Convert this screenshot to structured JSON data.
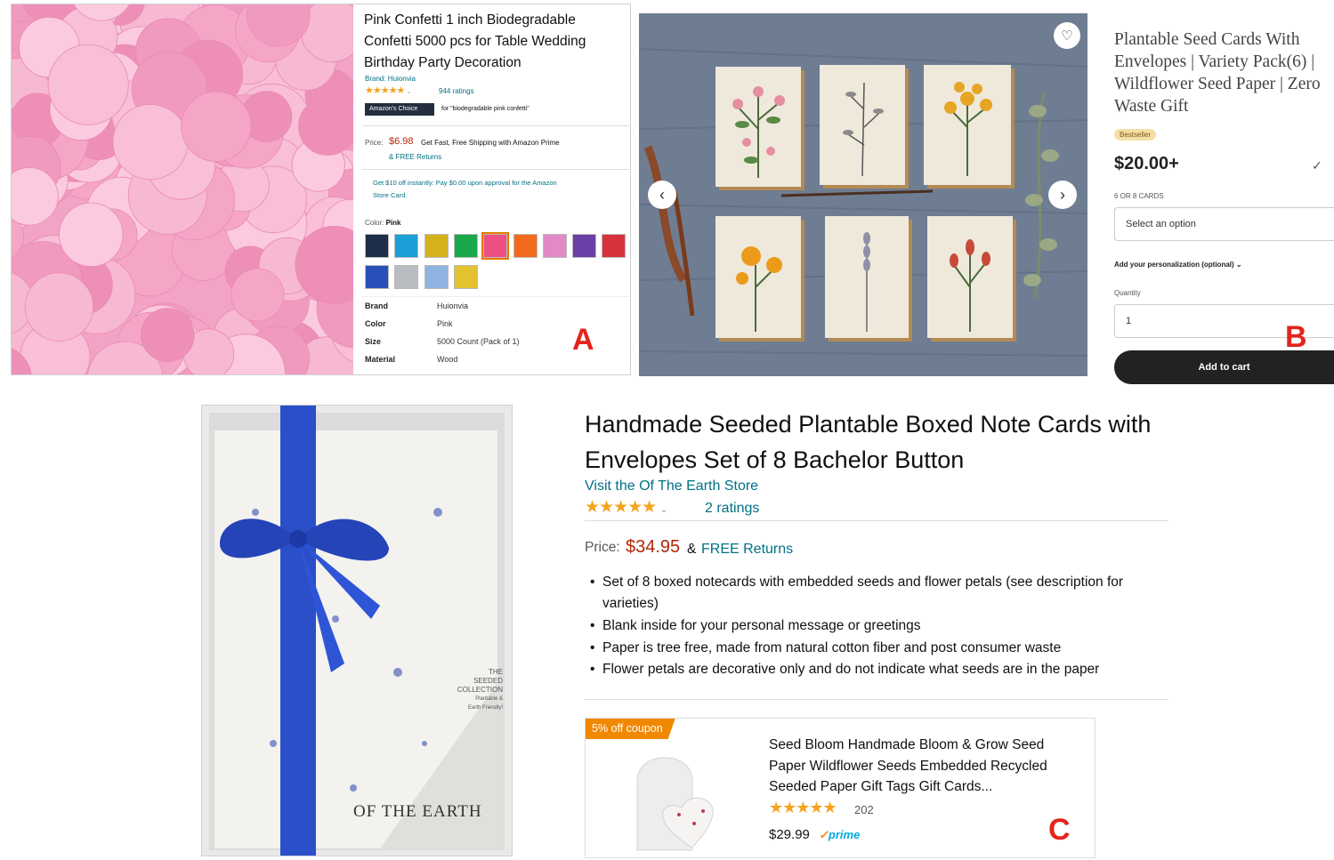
{
  "panel_a": {
    "title_lines": [
      "Pink Confetti 1 inch Biodegradable",
      "Confetti 5000 pcs for Table Wedding",
      "Birthday Party Decoration"
    ],
    "brand": "Brand: Huionvia",
    "rating_count": "944 ratings",
    "choice_badge": "Amazon's Choice",
    "choice_for": "for \"biodegradable pink confetti\"",
    "price_label": "Price:",
    "price": "$6.98",
    "shipping": "Get Fast, Free Shipping with Amazon Prime",
    "returns": "& FREE Returns",
    "promo_line1": "Get $10 off instantly: Pay $0.00 upon approval for the Amazon",
    "promo_line2": "Store Card.",
    "color_label": "Color:",
    "color_value": "Pink",
    "swatch_colors": [
      "#1d2d4a",
      "#1aa0d6",
      "#d4b21c",
      "#19a84a",
      "#ee4f83",
      "#f36a1c",
      "#e38ac6",
      "#6a3fa6",
      "#d6333a",
      "#2a4fb8",
      "#b9bcc0",
      "#8fb3e0",
      "#e3c230"
    ],
    "specs": [
      {
        "key": "Brand",
        "value": "Huionvia"
      },
      {
        "key": "Color",
        "value": "Pink"
      },
      {
        "key": "Size",
        "value": "5000 Count (Pack of 1)"
      },
      {
        "key": "Material",
        "value": "Wood"
      }
    ],
    "letter": "A"
  },
  "panel_b": {
    "title_lines": [
      "Plantable Seed Cards With",
      "Envelopes | Variety Pack(6) |",
      "Wildflower Seed Paper | Zero",
      "Waste Gift"
    ],
    "badge": "Bestseller",
    "price": "$20.00+",
    "cards_label": "6 OR 8 CARDS",
    "select_placeholder": "Select an option",
    "personalization": "Add your personalization (optional)",
    "quantity_label": "Quantity",
    "quantity_value": "1",
    "add_to_cart": "Add to cart",
    "letter": "B"
  },
  "panel_c": {
    "title_line1": "Handmade Seeded Plantable Boxed Note Cards with",
    "title_line2": "Envelopes Set of 8 Bachelor Button",
    "store_link": "Visit the Of The Earth Store",
    "ratings": "2 ratings",
    "price_label": "Price:",
    "price": "$34.95",
    "returns_amp": "&",
    "returns": "FREE Returns",
    "bullets": [
      [
        "Set of 8 boxed notecards with embedded seeds and flower petals (see description for",
        "varieties)"
      ],
      [
        "Blank inside for your personal message or greetings"
      ],
      [
        "Paper is tree free, made from natural cotton fiber and post consumer waste"
      ],
      [
        "Flower petals are decorative only and do not indicate what seeds are in the paper"
      ]
    ],
    "box_brand": "OF THE EARTH",
    "box_label_lines": [
      "THE",
      "SEEDED",
      "COLLECTION",
      "Plantable &",
      "Earth Friendly!"
    ],
    "coupon": "5% off coupon",
    "sponsored_title_lines": [
      "Seed Bloom Handmade Bloom & Grow Seed",
      "Paper Wildflower Seeds Embedded Recycled",
      "Seeded Paper Gift Tags Gift Cards..."
    ],
    "sponsored_rating_count": "202",
    "sponsored_price": "$29.99",
    "prime": "prime",
    "letter": "C"
  }
}
